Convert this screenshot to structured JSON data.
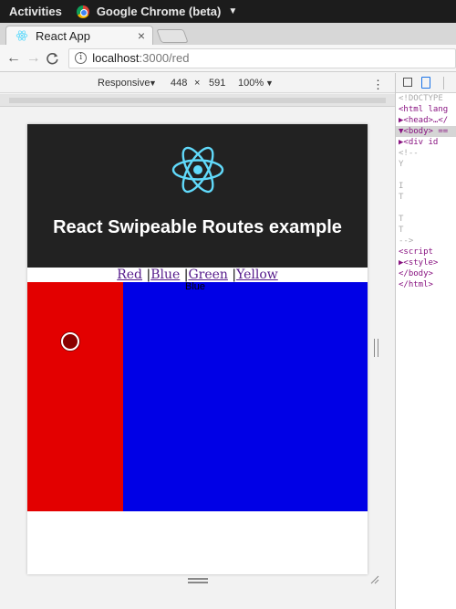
{
  "os": {
    "activities": "Activities",
    "app_name": "Google Chrome (beta)",
    "caret": "▼"
  },
  "tab": {
    "title": "React App",
    "close": "×"
  },
  "toolbar": {
    "back": "←",
    "forward": "→",
    "reload": "C",
    "url_host": "localhost",
    "url_path": ":3000/red",
    "info": "i"
  },
  "device_toolbar": {
    "mode": "Responsive",
    "mode_caret": "▼",
    "width": "448",
    "times": "×",
    "height": "591",
    "zoom": "100%",
    "zoom_caret": "▼",
    "more": "⋮"
  },
  "page": {
    "title": "React Swipeable Routes example",
    "links": [
      {
        "label": "Red"
      },
      {
        "label": "Blue"
      },
      {
        "label": "Green"
      },
      {
        "label": "Yellow"
      }
    ],
    "link_separator": " |",
    "overlapping_label": "Blue",
    "colors": {
      "header_bg": "#222222",
      "red": "#e30000",
      "blue": "#0000e6",
      "logo": "#61dafb"
    }
  },
  "devtools": {
    "lines": [
      {
        "text": "<!DOCTYPE",
        "kind": "comment"
      },
      {
        "text": "<html lang",
        "kind": "tag"
      },
      {
        "text": "▶<head>…</",
        "kind": "tag"
      },
      {
        "text": "▼<body> ==",
        "kind": "tag",
        "selected": true
      },
      {
        "text": " ▶<div id",
        "kind": "tag"
      },
      {
        "text": "  <!--",
        "kind": "comment"
      },
      {
        "text": "      Y",
        "kind": "comment"
      },
      {
        "text": "",
        "kind": "comment"
      },
      {
        "text": "      I",
        "kind": "comment"
      },
      {
        "text": "      T",
        "kind": "comment"
      },
      {
        "text": "",
        "kind": "comment"
      },
      {
        "text": "      T",
        "kind": "comment"
      },
      {
        "text": "      T",
        "kind": "comment"
      },
      {
        "text": "    -->",
        "kind": "comment"
      },
      {
        "text": "  <script",
        "kind": "tag"
      },
      {
        "text": " ▶<style>",
        "kind": "tag"
      },
      {
        "text": "  </body>",
        "kind": "tag"
      },
      {
        "text": "</html>",
        "kind": "tag"
      }
    ]
  }
}
